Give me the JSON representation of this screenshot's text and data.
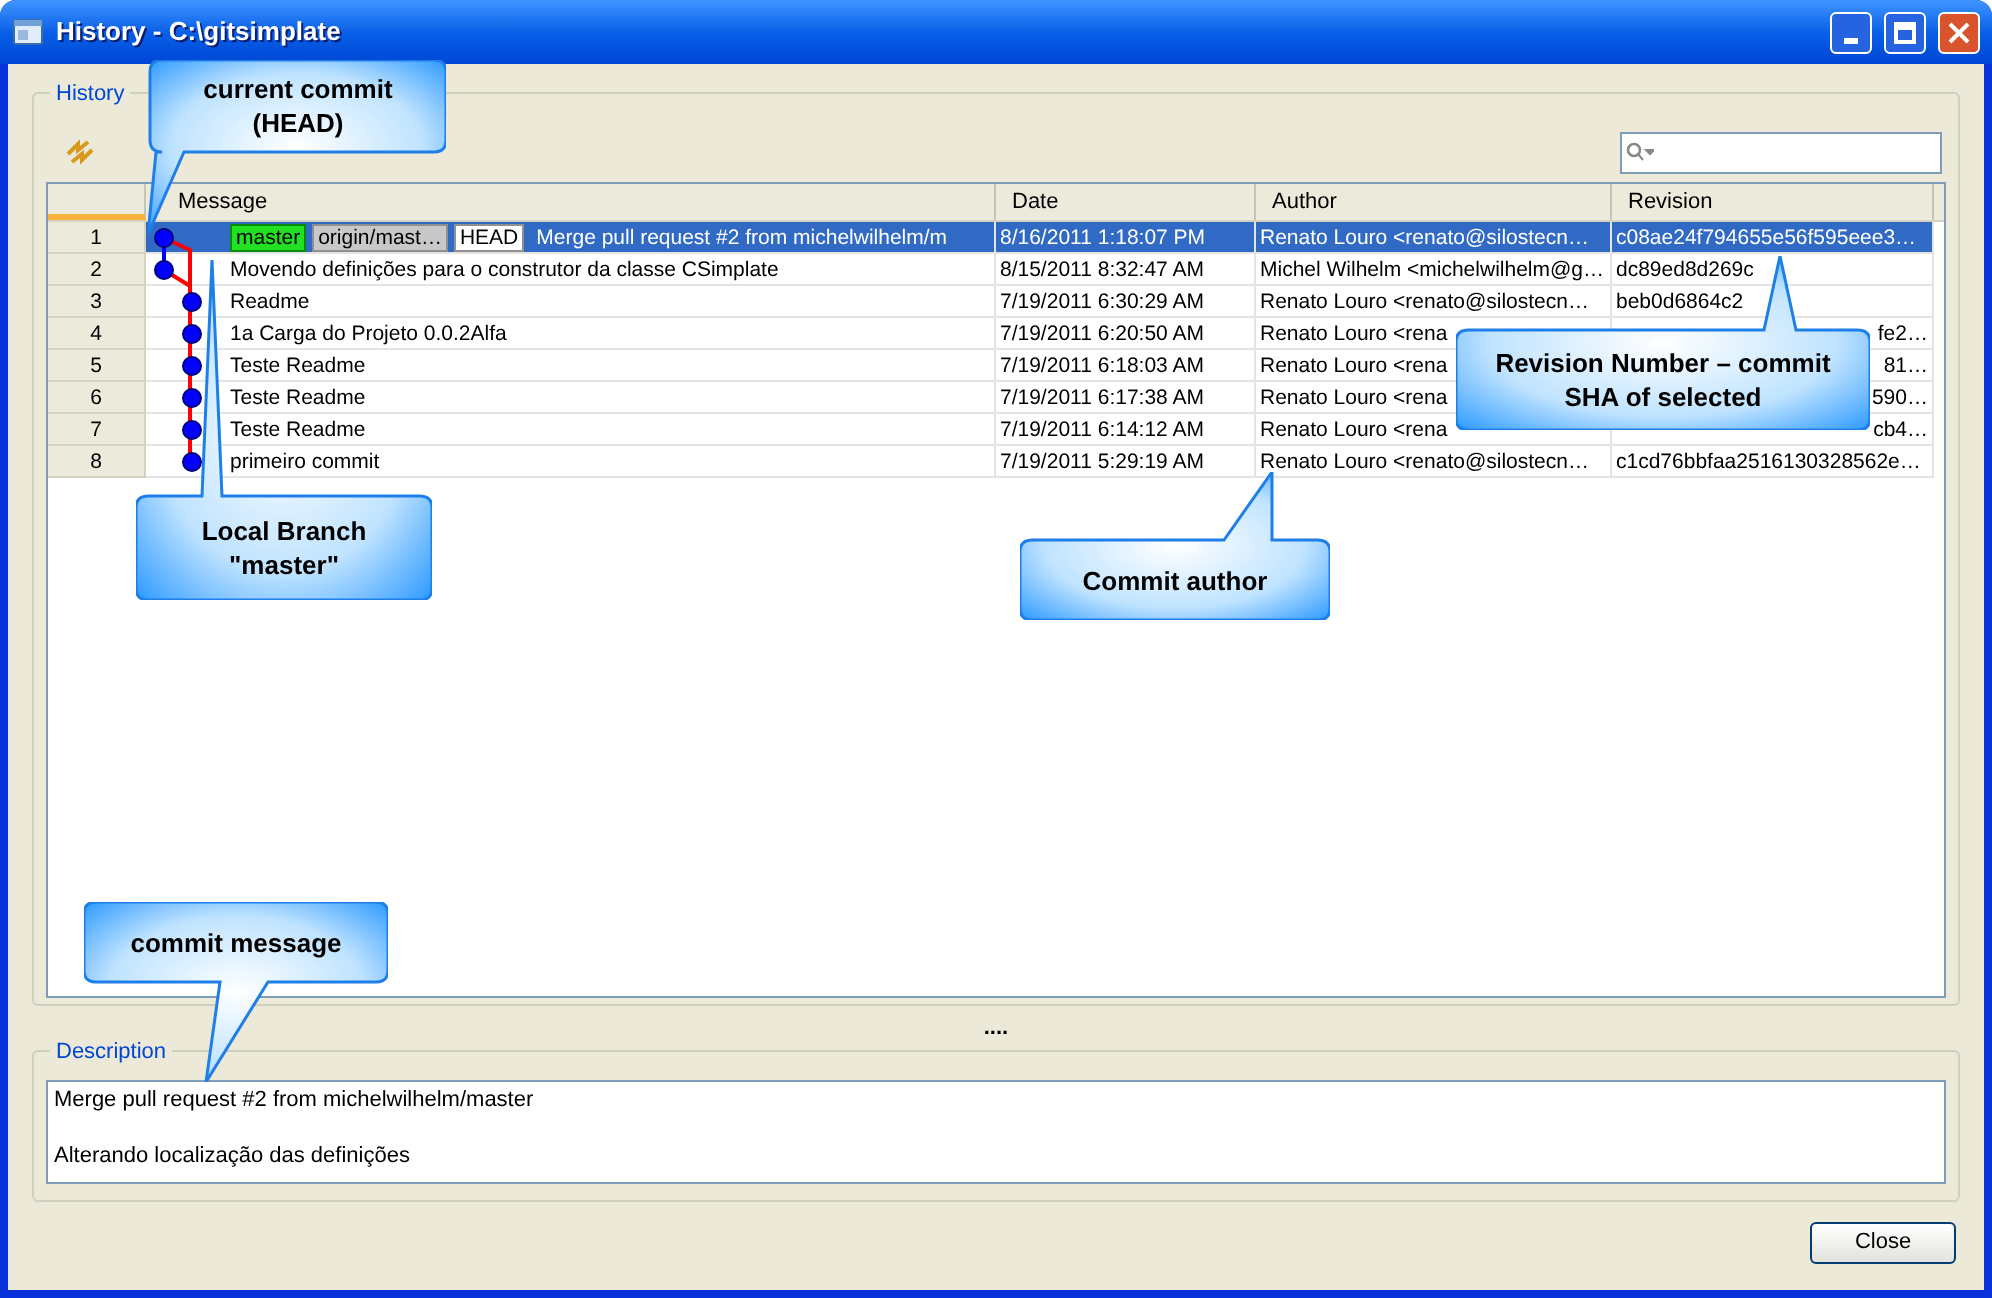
{
  "window": {
    "title": "History - C:\\gitsimplate"
  },
  "history": {
    "label": "History",
    "table": {
      "columns": [
        "",
        "Message",
        "Date",
        "Author",
        "Revision"
      ],
      "rows": [
        {
          "number": "1",
          "selected": true,
          "refs": [
            {
              "label": "master",
              "kind": "local"
            },
            {
              "label": "origin/mast…",
              "kind": "remote"
            },
            {
              "label": "HEAD",
              "kind": "head"
            }
          ],
          "message": "Merge pull request #2 from michelwilhelm/m",
          "date": "8/16/2011 1:18:07 PM",
          "author": "Renato Louro <renato@silostecn…",
          "revision": "c08ae24f794655e56f595eee3…"
        },
        {
          "number": "2",
          "selected": false,
          "message": "Movendo definições para o construtor da classe CSimplate",
          "date": "8/15/2011 8:32:47 AM",
          "author": "Michel Wilhelm <michelwilhelm@g…",
          "revision": "dc89ed8d269c"
        },
        {
          "number": "3",
          "selected": false,
          "message": "Readme",
          "date": "7/19/2011 6:30:29 AM",
          "author": "Renato Louro <renato@silostecn…",
          "revision": "beb0d6864c2"
        },
        {
          "number": "4",
          "selected": false,
          "message": "1a Carga do Projeto 0.0.2Alfa",
          "date": "7/19/2011 6:20:50 AM",
          "author": "Renato Louro <rena",
          "revision": "fe2…"
        },
        {
          "number": "5",
          "selected": false,
          "message": "Teste Readme",
          "date": "7/19/2011 6:18:03 AM",
          "author": "Renato Louro <rena",
          "revision": "81…"
        },
        {
          "number": "6",
          "selected": false,
          "message": "Teste Readme",
          "date": "7/19/2011 6:17:38 AM",
          "author": "Renato Louro <rena",
          "revision": "590…"
        },
        {
          "number": "7",
          "selected": false,
          "message": "Teste Readme",
          "date": "7/19/2011 6:14:12 AM",
          "author": "Renato Louro <rena",
          "revision": "cb4…"
        },
        {
          "number": "8",
          "selected": false,
          "message": "primeiro commit",
          "date": "7/19/2011 5:29:19 AM",
          "author": "Renato Louro <renato@silostecn…",
          "revision": "c1cd76bbfaa2516130328562e…"
        }
      ]
    }
  },
  "splitter": "....",
  "description": {
    "label": "Description",
    "lines": [
      "Merge pull request #2 from michelwilhelm/master",
      "Alterando localização das definições"
    ]
  },
  "buttons": [
    "Close"
  ],
  "callouts": [
    {
      "text": "current commit (HEAD)"
    },
    {
      "text": "Local Branch \"master\""
    },
    {
      "text": "Commit author"
    },
    {
      "text": "Revision Number – commit SHA of selected"
    },
    {
      "text": "commit message"
    }
  ]
}
